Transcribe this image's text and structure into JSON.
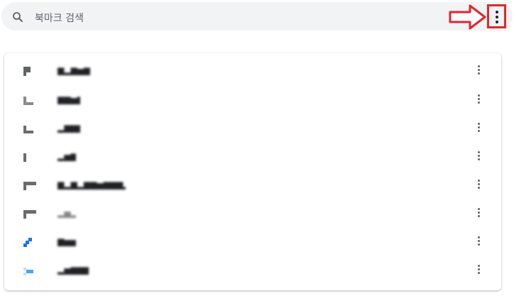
{
  "search": {
    "placeholder": "북마크 검색"
  },
  "bookmarks": [
    {
      "title": "▆▂▆▅▆▆▅",
      "favicon": "gray-square-favicon",
      "color": "#5f6368"
    },
    {
      "title": "▆▆▅▆▆",
      "favicon": "gray-corner-favicon",
      "color": "#808080"
    },
    {
      "title": "▂▆▆▆▆",
      "favicon": "gray-bracket-favicon",
      "color": "#6b6b6b"
    },
    {
      "title": "▂▅▆▆",
      "favicon": "gray-bar-favicon",
      "color": "#6b6b6b"
    },
    {
      "title": "▆▂▆▂▆▆▅▆▆▆▂▆▆▆▆",
      "favicon": "gray-flag-favicon",
      "color": "#6b6b6b"
    },
    {
      "title": "▂▅▂▅",
      "favicon": "gray-flag-favicon-2",
      "color": "#6b6b6b"
    },
    {
      "title": "▆▅▅▆",
      "favicon": "blue-diagonal-favicon",
      "color": "#1a73e8"
    },
    {
      "title": "▂▅▆▆▆▆▆",
      "favicon": "lightblue-favicon",
      "color": "#4da3f5"
    }
  ]
}
